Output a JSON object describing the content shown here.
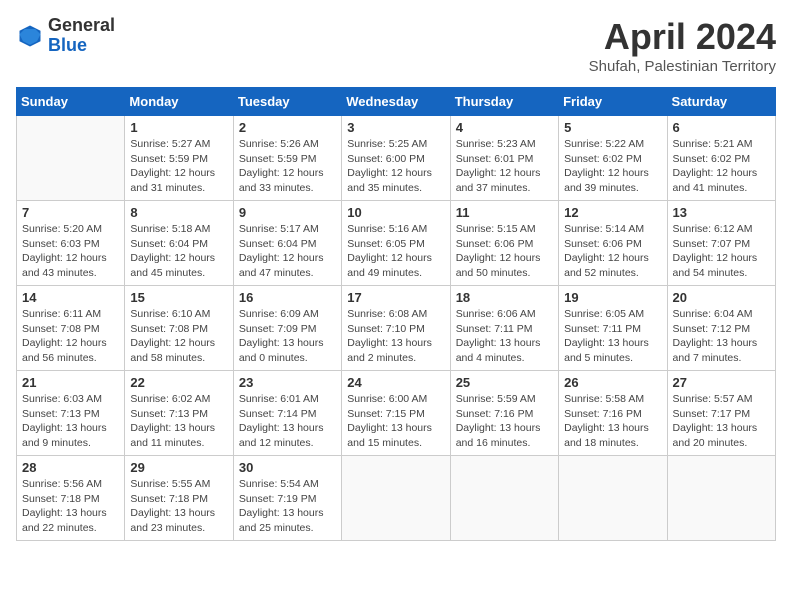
{
  "header": {
    "logo_general": "General",
    "logo_blue": "Blue",
    "month_title": "April 2024",
    "location": "Shufah, Palestinian Territory"
  },
  "weekdays": [
    "Sunday",
    "Monday",
    "Tuesday",
    "Wednesday",
    "Thursday",
    "Friday",
    "Saturday"
  ],
  "weeks": [
    [
      {
        "day": "",
        "empty": true
      },
      {
        "day": "1",
        "sunrise": "Sunrise: 5:27 AM",
        "sunset": "Sunset: 5:59 PM",
        "daylight": "Daylight: 12 hours and 31 minutes."
      },
      {
        "day": "2",
        "sunrise": "Sunrise: 5:26 AM",
        "sunset": "Sunset: 5:59 PM",
        "daylight": "Daylight: 12 hours and 33 minutes."
      },
      {
        "day": "3",
        "sunrise": "Sunrise: 5:25 AM",
        "sunset": "Sunset: 6:00 PM",
        "daylight": "Daylight: 12 hours and 35 minutes."
      },
      {
        "day": "4",
        "sunrise": "Sunrise: 5:23 AM",
        "sunset": "Sunset: 6:01 PM",
        "daylight": "Daylight: 12 hours and 37 minutes."
      },
      {
        "day": "5",
        "sunrise": "Sunrise: 5:22 AM",
        "sunset": "Sunset: 6:02 PM",
        "daylight": "Daylight: 12 hours and 39 minutes."
      },
      {
        "day": "6",
        "sunrise": "Sunrise: 5:21 AM",
        "sunset": "Sunset: 6:02 PM",
        "daylight": "Daylight: 12 hours and 41 minutes."
      }
    ],
    [
      {
        "day": "7",
        "sunrise": "Sunrise: 5:20 AM",
        "sunset": "Sunset: 6:03 PM",
        "daylight": "Daylight: 12 hours and 43 minutes."
      },
      {
        "day": "8",
        "sunrise": "Sunrise: 5:18 AM",
        "sunset": "Sunset: 6:04 PM",
        "daylight": "Daylight: 12 hours and 45 minutes."
      },
      {
        "day": "9",
        "sunrise": "Sunrise: 5:17 AM",
        "sunset": "Sunset: 6:04 PM",
        "daylight": "Daylight: 12 hours and 47 minutes."
      },
      {
        "day": "10",
        "sunrise": "Sunrise: 5:16 AM",
        "sunset": "Sunset: 6:05 PM",
        "daylight": "Daylight: 12 hours and 49 minutes."
      },
      {
        "day": "11",
        "sunrise": "Sunrise: 5:15 AM",
        "sunset": "Sunset: 6:06 PM",
        "daylight": "Daylight: 12 hours and 50 minutes."
      },
      {
        "day": "12",
        "sunrise": "Sunrise: 5:14 AM",
        "sunset": "Sunset: 6:06 PM",
        "daylight": "Daylight: 12 hours and 52 minutes."
      },
      {
        "day": "13",
        "sunrise": "Sunrise: 6:12 AM",
        "sunset": "Sunset: 7:07 PM",
        "daylight": "Daylight: 12 hours and 54 minutes."
      }
    ],
    [
      {
        "day": "14",
        "sunrise": "Sunrise: 6:11 AM",
        "sunset": "Sunset: 7:08 PM",
        "daylight": "Daylight: 12 hours and 56 minutes."
      },
      {
        "day": "15",
        "sunrise": "Sunrise: 6:10 AM",
        "sunset": "Sunset: 7:08 PM",
        "daylight": "Daylight: 12 hours and 58 minutes."
      },
      {
        "day": "16",
        "sunrise": "Sunrise: 6:09 AM",
        "sunset": "Sunset: 7:09 PM",
        "daylight": "Daylight: 13 hours and 0 minutes."
      },
      {
        "day": "17",
        "sunrise": "Sunrise: 6:08 AM",
        "sunset": "Sunset: 7:10 PM",
        "daylight": "Daylight: 13 hours and 2 minutes."
      },
      {
        "day": "18",
        "sunrise": "Sunrise: 6:06 AM",
        "sunset": "Sunset: 7:11 PM",
        "daylight": "Daylight: 13 hours and 4 minutes."
      },
      {
        "day": "19",
        "sunrise": "Sunrise: 6:05 AM",
        "sunset": "Sunset: 7:11 PM",
        "daylight": "Daylight: 13 hours and 5 minutes."
      },
      {
        "day": "20",
        "sunrise": "Sunrise: 6:04 AM",
        "sunset": "Sunset: 7:12 PM",
        "daylight": "Daylight: 13 hours and 7 minutes."
      }
    ],
    [
      {
        "day": "21",
        "sunrise": "Sunrise: 6:03 AM",
        "sunset": "Sunset: 7:13 PM",
        "daylight": "Daylight: 13 hours and 9 minutes."
      },
      {
        "day": "22",
        "sunrise": "Sunrise: 6:02 AM",
        "sunset": "Sunset: 7:13 PM",
        "daylight": "Daylight: 13 hours and 11 minutes."
      },
      {
        "day": "23",
        "sunrise": "Sunrise: 6:01 AM",
        "sunset": "Sunset: 7:14 PM",
        "daylight": "Daylight: 13 hours and 12 minutes."
      },
      {
        "day": "24",
        "sunrise": "Sunrise: 6:00 AM",
        "sunset": "Sunset: 7:15 PM",
        "daylight": "Daylight: 13 hours and 15 minutes."
      },
      {
        "day": "25",
        "sunrise": "Sunrise: 5:59 AM",
        "sunset": "Sunset: 7:16 PM",
        "daylight": "Daylight: 13 hours and 16 minutes."
      },
      {
        "day": "26",
        "sunrise": "Sunrise: 5:58 AM",
        "sunset": "Sunset: 7:16 PM",
        "daylight": "Daylight: 13 hours and 18 minutes."
      },
      {
        "day": "27",
        "sunrise": "Sunrise: 5:57 AM",
        "sunset": "Sunset: 7:17 PM",
        "daylight": "Daylight: 13 hours and 20 minutes."
      }
    ],
    [
      {
        "day": "28",
        "sunrise": "Sunrise: 5:56 AM",
        "sunset": "Sunset: 7:18 PM",
        "daylight": "Daylight: 13 hours and 22 minutes."
      },
      {
        "day": "29",
        "sunrise": "Sunrise: 5:55 AM",
        "sunset": "Sunset: 7:18 PM",
        "daylight": "Daylight: 13 hours and 23 minutes."
      },
      {
        "day": "30",
        "sunrise": "Sunrise: 5:54 AM",
        "sunset": "Sunset: 7:19 PM",
        "daylight": "Daylight: 13 hours and 25 minutes."
      },
      {
        "day": "",
        "empty": true
      },
      {
        "day": "",
        "empty": true
      },
      {
        "day": "",
        "empty": true
      },
      {
        "day": "",
        "empty": true
      }
    ]
  ]
}
